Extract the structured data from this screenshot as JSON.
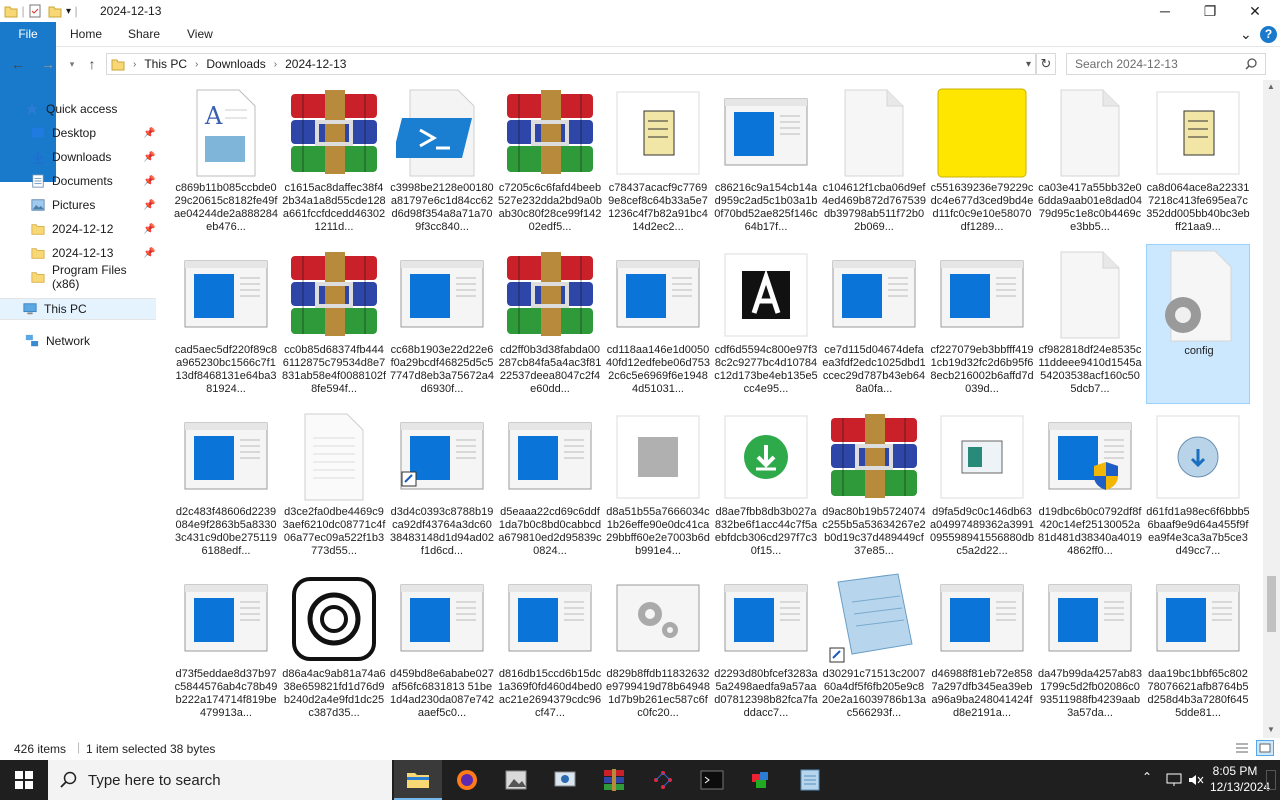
{
  "window": {
    "title": "2024-12-13",
    "minimize": "─",
    "maximize": "❐",
    "close": "✕"
  },
  "ribbon": {
    "tabs": [
      "File",
      "Home",
      "Share",
      "View"
    ],
    "expand": "⌄",
    "help": "?"
  },
  "address": {
    "breadcrumbs": [
      "This PC",
      "Downloads",
      "2024-12-13"
    ],
    "search_placeholder": "Search 2024-12-13"
  },
  "sidebar": {
    "items": [
      {
        "label": "Quick access",
        "icon": "star-icon",
        "pinned": false
      },
      {
        "label": "Desktop",
        "icon": "desktop-folder-icon",
        "pinned": true
      },
      {
        "label": "Downloads",
        "icon": "download-arrow-icon",
        "pinned": true
      },
      {
        "label": "Documents",
        "icon": "documents-folder-icon",
        "pinned": true
      },
      {
        "label": "Pictures",
        "icon": "pictures-folder-icon",
        "pinned": true
      },
      {
        "label": "2024-12-12",
        "icon": "folder-icon",
        "pinned": true
      },
      {
        "label": "2024-12-13",
        "icon": "folder-icon",
        "pinned": true
      },
      {
        "label": "Program Files (x86)",
        "icon": "folder-icon",
        "pinned": false
      },
      {
        "label": "This PC",
        "icon": "computer-icon",
        "pinned": false
      },
      {
        "label": "Network",
        "icon": "network-icon",
        "pinned": false
      }
    ],
    "pin_glyph": "📌"
  },
  "files": [
    {
      "name": "c869b11b085ccbde029c20615c8182fe49fae04244de2a888284eb476...",
      "icon": "document-image-icon"
    },
    {
      "name": "c1615ac8daffec38f42b34a1a8d55cde128a661fccfdcedd463021211d...",
      "icon": "winrar-archive-icon"
    },
    {
      "name": "c3998be2128e00180a81797e6c1d84cc62d6d98f354a8a71a709f3cc840...",
      "icon": "powershell-script-icon"
    },
    {
      "name": "c7205c6c6fafd4beeb527e232dda2bd9a0bab30c80f28ce99f14202edf5...",
      "icon": "winrar-archive-icon"
    },
    {
      "name": "c78437acacf9c77699e8cef8c64b33a5e71236c4f7b82a91bc414d2ec2...",
      "icon": "script-scroll-icon"
    },
    {
      "name": "c86216c9a154cb14ad959c2ad5c1b03a1b0f70bd52ae825f146c64b17f...",
      "icon": "generic-app-window-icon"
    },
    {
      "name": "c104612f1cba06d9ef4ed469b872d767539db39798ab511f72b02b069...",
      "icon": "blank-file-icon"
    },
    {
      "name": "c551639236e79229cdc4e677d3ced9bd4ed11fc0c9e10e58070df1289...",
      "icon": "yellow-note-icon"
    },
    {
      "name": "ca03e417a55bb32e06dda9aab01e8dad0479d95c1e8c0b4469ce3bb5...",
      "icon": "blank-file-icon"
    },
    {
      "name": "ca8d064ace8a223317218c413fe695ea7c352dd005bb40bc3ebff21aa9...",
      "icon": "script-scroll-icon"
    },
    {
      "name": "cad5aec5df220f89c8a965230bc1566c7f113df8468131e64ba381924...",
      "icon": "generic-app-window-icon"
    },
    {
      "name": "cc0b85d68374fb4446112875c79534d8e7831ab58e4f0088102f8fe594f...",
      "icon": "winrar-archive-icon"
    },
    {
      "name": "cc68b1903e22d22e6f0a29bcdf46825d5c57747d8eb3a75672a4d6930f...",
      "icon": "generic-app-window-icon"
    },
    {
      "name": "cd2ff0b3d38fabda00287cb84fa5a4ac3f8122537deea8047c2f4e60dd...",
      "icon": "winrar-archive-icon"
    },
    {
      "name": "cd118aa146e1d005040fd12edfebe06d7532c6c5e6969f6e19484d51031...",
      "icon": "generic-app-window-icon"
    },
    {
      "name": "cdf6d5594c800e97f38c2c9277bc4d10784c12d173be4eb135e5cc4e95...",
      "icon": "font-a-icon"
    },
    {
      "name": "ce7d115d04674defaea3fdf2edc1025dbd1ccec29d787b43eb648a0fa...",
      "icon": "generic-app-window-icon"
    },
    {
      "name": "cf227079eb3bbfff4191cb19d32fc2d6b95f68ecb216002b6affd7d039d...",
      "icon": "generic-app-window-icon"
    },
    {
      "name": "cf982818df24e8535c11ddeee9410d1545a54203538acf160c505dcb7...",
      "icon": "blank-file-icon"
    },
    {
      "name": "config",
      "icon": "config-gear-file-icon",
      "selected": true
    },
    {
      "name": "d2c483f48606d2239084e9f2863b5a83303c431c9d0be2751196188edf...",
      "icon": "generic-app-window-icon"
    },
    {
      "name": "d3ce2fa0dbe4469c93aef6210dc08771c4f06a77ec09a522f1b3773d55...",
      "icon": "text-document-icon"
    },
    {
      "name": "d3d4c0393c8788b19ca92df43764a3dc6038483148d1d94ad02f1d6cd...",
      "icon": "generic-app-shortcut-icon"
    },
    {
      "name": "d5eaaa22cd69c6ddf1da7b0c8bd0cabbcda679810ed2d95839c0824...",
      "icon": "generic-app-window-icon"
    },
    {
      "name": "d8a51b55a7666034c1b26effe90e0dc41ca29bbff60e2e7003b6db991e4...",
      "icon": "blurred-image-icon"
    },
    {
      "name": "d8ae7fbb8db3b027a832be6f1acc44c7f5aebfdcb306cd297f7c30f15...",
      "icon": "download-installer-icon"
    },
    {
      "name": "d9ac80b19b5724074c255b5a53634267e2b0d19c37d489449cf37e85...",
      "icon": "winrar-archive-icon"
    },
    {
      "name": "d9fa5d9c0c146db63a04997489362a3991095598941556880dbc5a2d22...",
      "icon": "control-panel-icon"
    },
    {
      "name": "d19dbc6b0c0792df8f420c14ef25130052a81d481d38340a40194862ff0...",
      "icon": "uac-shield-app-icon"
    },
    {
      "name": "d61fd1a98ec6f6bbb56baaf9e9d64a455f9fea9f4e3ca3a7b5ce3d49cc7...",
      "icon": "setup-globe-icon"
    },
    {
      "name": "d73f5eddae8d37b97c5844576ab4c78b49b222a174714f819be479913a...",
      "icon": "generic-app-window-icon"
    },
    {
      "name": "d86a4ac9ab81a74a638e659821fd1d76d9b240d2a4e9fd1dc25c387d35...",
      "icon": "circular-logo-icon"
    },
    {
      "name": "d459bd8e6ababe027af56fc6831813 51be1d4ad230da087e742aaef5c0...",
      "icon": "generic-app-window-icon"
    },
    {
      "name": "d816db15ccd6b15dc1a369f0fd460d4bed0ac21e2694379cdc96cf47...",
      "icon": "generic-app-window-icon"
    },
    {
      "name": "d829b8ffdb11832632e9799419d78b649481d7b9b261ec587c6fc0fc20...",
      "icon": "settings-gears-icon"
    },
    {
      "name": "d2293d80bfcef3283a5a2498aedfa9a57aad07812398b82fca7faddacc7...",
      "icon": "generic-app-window-icon"
    },
    {
      "name": "d30291c71513c200760a4df5f6fb205e9c820e2a16039786b13ac566293f...",
      "icon": "notepad-shortcut-icon"
    },
    {
      "name": "d46988f81eb72e8587a297dfb345ea39eba96a9ba248041424fd8e2191a...",
      "icon": "generic-app-window-icon"
    },
    {
      "name": "da47b99da4257ab831799c5d2fb02086c093511988fb4239aab3a57da...",
      "icon": "generic-app-window-icon"
    },
    {
      "name": "daa19bc1bbf65c80278076621afb8764b5d258d4b3a7280f6455dde81...",
      "icon": "generic-app-window-icon"
    }
  ],
  "status": {
    "count": "426 items",
    "selection": "1 item selected",
    "size": "38 bytes"
  },
  "taskbar": {
    "search_placeholder": "Type here to search",
    "apps": [
      "file-explorer-icon",
      "firefox-icon",
      "photos-app-icon",
      "screen-capture-icon",
      "winrar-icon",
      "network-graph-icon",
      "terminal-icon",
      "paint-icon",
      "notepad-icon"
    ],
    "time": "8:05 PM",
    "date": "12/13/2024"
  },
  "colors": {
    "accent": "#1979ca",
    "selection": "#cce8ff",
    "taskbar": "#1f1f1f",
    "folder": "#f8d775"
  }
}
